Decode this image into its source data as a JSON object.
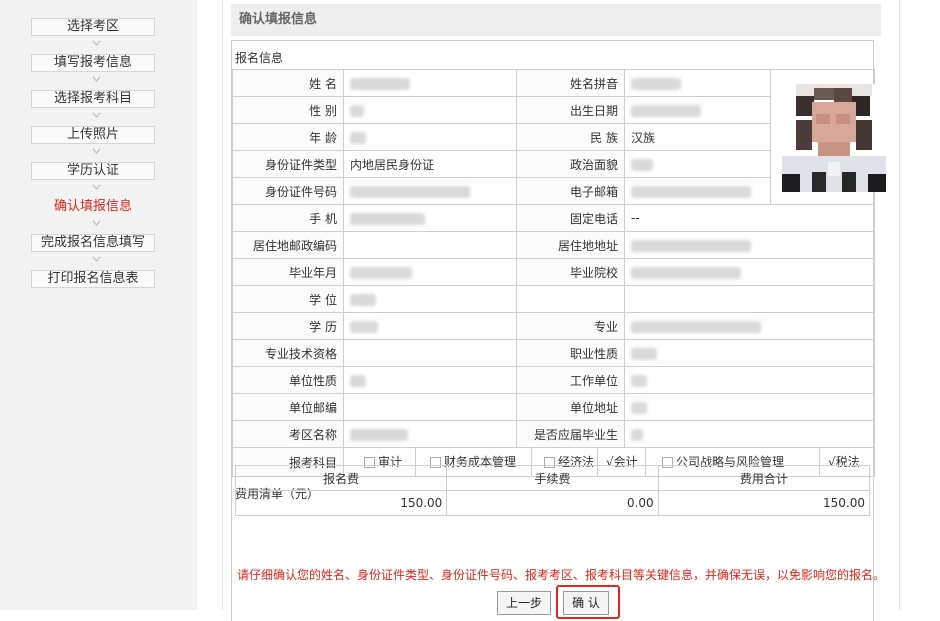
{
  "sidebar": {
    "steps": [
      {
        "label": "选择考区"
      },
      {
        "label": "填写报考信息"
      },
      {
        "label": "选择报考科目"
      },
      {
        "label": "上传照片"
      },
      {
        "label": "学历认证"
      },
      {
        "label": "确认填报信息"
      },
      {
        "label": "完成报名信息填写"
      },
      {
        "label": "打印报名信息表"
      }
    ]
  },
  "header": {
    "title": "确认填报信息"
  },
  "section": {
    "info_title": "报名信息",
    "fee_title": "费用清单（元）"
  },
  "form": {
    "labels": {
      "name": "姓 名",
      "name_pinyin": "姓名拼音",
      "gender": "性 别",
      "birth": "出生日期",
      "age": "年 龄",
      "ethnicity": "民 族",
      "id_type": "身份证件类型",
      "political": "政治面貌",
      "id_no": "身份证件号码",
      "email": "电子邮箱",
      "mobile": "手 机",
      "phone": "固定电话",
      "postcode": "居住地邮政编码",
      "address": "居住地地址",
      "grad_date": "毕业年月",
      "school": "毕业院校",
      "degree": "学 位",
      "education": "学 历",
      "major": "专业",
      "qualification": "专业技术资格",
      "job_type": "职业性质",
      "unit_type": "单位性质",
      "unit": "工作单位",
      "unit_post": "单位邮编",
      "unit_addr": "单位地址",
      "exam_area": "考区名称",
      "fresh_grad": "是否应届毕业生",
      "subjects": "报考科目"
    },
    "values": {
      "ethnicity": "汉族",
      "id_type": "内地居民身份证",
      "phone": "--"
    }
  },
  "subjects": [
    {
      "label": "审计",
      "checked": false
    },
    {
      "label": "财务成本管理",
      "checked": false
    },
    {
      "label": "经济法",
      "checked": false
    },
    {
      "label": "会计",
      "checked": true
    },
    {
      "label": "公司战略与风险管理",
      "checked": false
    },
    {
      "label": "税法",
      "checked": true
    }
  ],
  "fees": {
    "headers": [
      "报名费",
      "手续费",
      "费用合计"
    ],
    "values": [
      "150.00",
      "0.00",
      "150.00"
    ]
  },
  "warning": "请仔细确认您的姓名、身份证件类型、身份证件号码、报考考区、报考科目等关键信息，并确保无误，以免影响您的报名。",
  "buttons": {
    "prev": "上一步",
    "confirm": "确 认"
  },
  "colors": {
    "accent": "#e0261c"
  }
}
